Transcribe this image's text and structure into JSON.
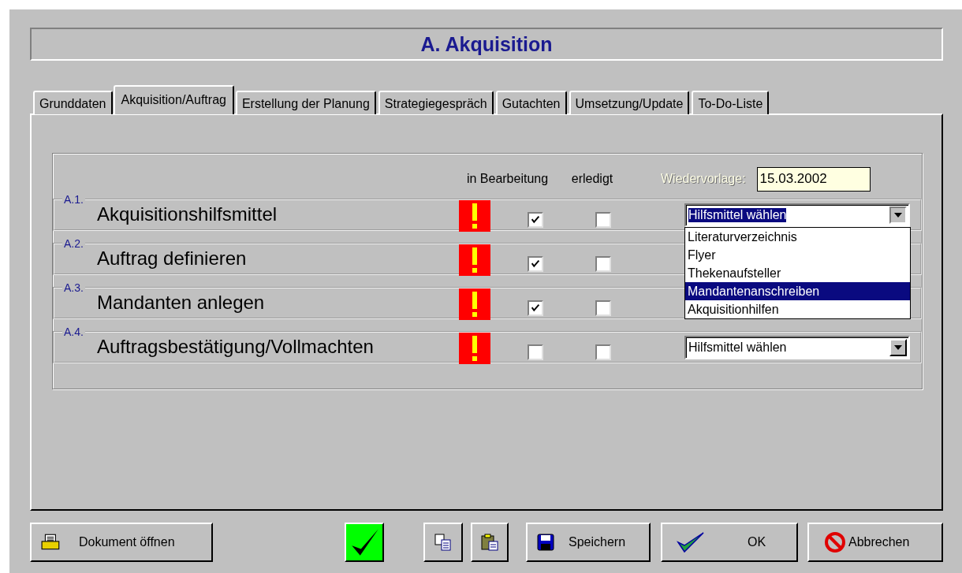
{
  "window": {
    "title": "A. Akquisition"
  },
  "tabs": [
    {
      "label": "Grunddaten",
      "selected": false
    },
    {
      "label": "Akquisition/Auftrag",
      "selected": true
    },
    {
      "label": "Erstellung der Planung",
      "selected": false
    },
    {
      "label": "Strategiegespräch",
      "selected": false
    },
    {
      "label": "Gutachten",
      "selected": false
    },
    {
      "label": "Umsetzung/Update",
      "selected": false
    },
    {
      "label": "To-Do-Liste",
      "selected": false
    }
  ],
  "columns": {
    "in_progress": "in Bearbeitung",
    "done": "erledigt"
  },
  "follow_up": {
    "label": "Wiedervorlage:",
    "value": "15.03.2002"
  },
  "tasks": [
    {
      "number": "A.1.",
      "title": "Akquisitionshilfsmittel",
      "warning": true,
      "in_progress": true,
      "done": false,
      "dropdown": {
        "value": "Hilfsmittel wählen",
        "focused": true,
        "expanded": true,
        "options": [
          {
            "label": "Literaturverzeichnis",
            "selected": false
          },
          {
            "label": "Flyer",
            "selected": false
          },
          {
            "label": "Thekenaufsteller",
            "selected": false
          },
          {
            "label": "Mandantenanschreiben",
            "selected": true
          },
          {
            "label": "Akquisitionhilfen",
            "selected": false
          }
        ]
      }
    },
    {
      "number": "A.2.",
      "title": "Auftrag definieren",
      "warning": true,
      "in_progress": true,
      "done": false
    },
    {
      "number": "A.3.",
      "title": "Mandanten anlegen",
      "warning": true,
      "in_progress": true,
      "done": false
    },
    {
      "number": "A.4.",
      "title": "Auftragsbestätigung/Vollmachten",
      "warning": true,
      "in_progress": false,
      "done": false,
      "dropdown": {
        "value": "Hilfsmittel wählen",
        "focused": false,
        "expanded": false
      }
    }
  ],
  "buttons": [
    {
      "kind": "open",
      "label": "Dokument öffnen"
    },
    {
      "kind": "confirm"
    },
    {
      "kind": "copy"
    },
    {
      "kind": "paste"
    },
    {
      "kind": "save",
      "label": "Speichern"
    },
    {
      "kind": "ok",
      "label": "OK"
    },
    {
      "kind": "cancel",
      "label": "Abbrechen"
    }
  ]
}
